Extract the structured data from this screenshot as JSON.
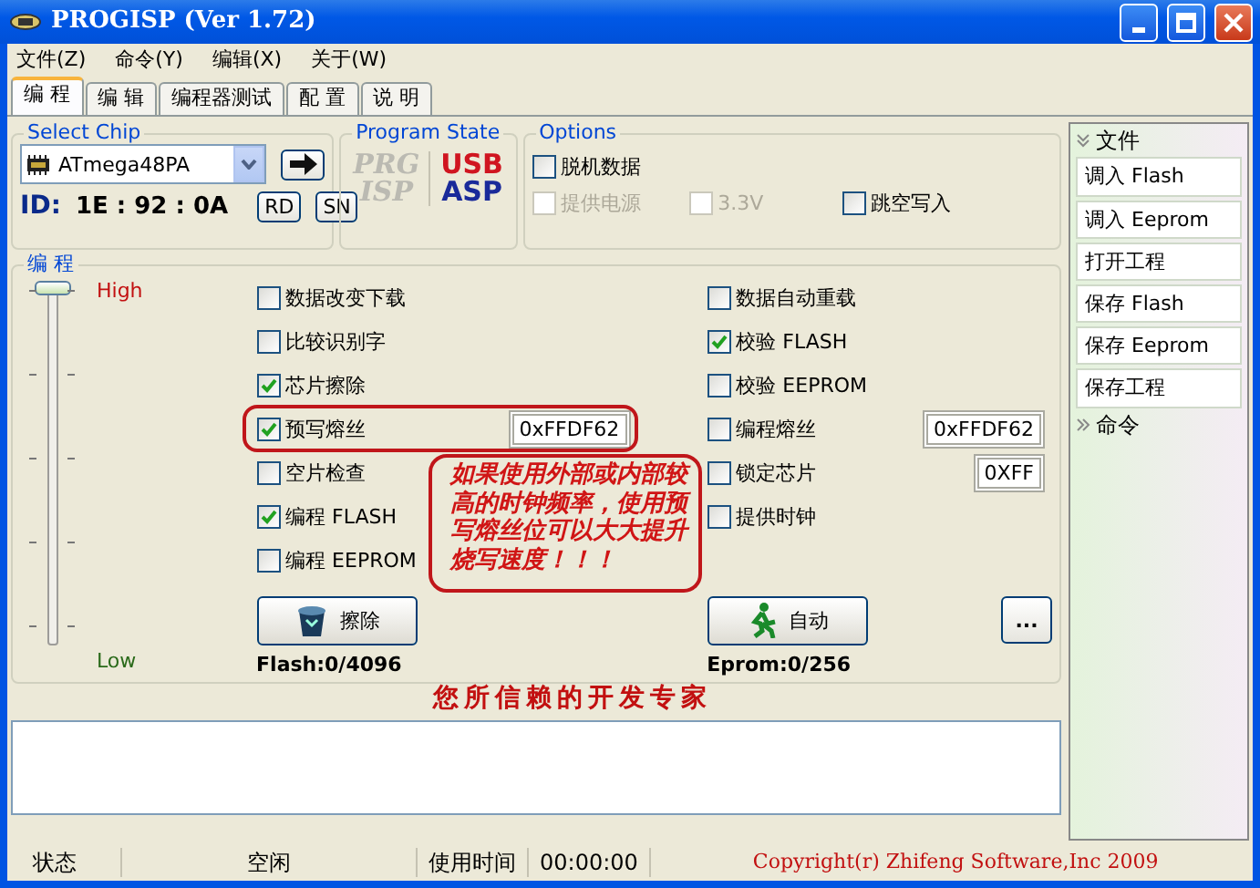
{
  "window": {
    "title": "PROGISP (Ver 1.72)"
  },
  "menu": [
    "文件(Z)",
    "命令(Y)",
    "编辑(X)",
    "关于(W)"
  ],
  "tabs": [
    {
      "label": "编 程",
      "selected": true
    },
    {
      "label": "编 辑",
      "selected": false
    },
    {
      "label": "编程器测试",
      "selected": false
    },
    {
      "label": "配 置",
      "selected": false
    },
    {
      "label": "说 明",
      "selected": false
    }
  ],
  "select_chip": {
    "title": "Select Chip",
    "chip": "ATmega48PA",
    "id_label": "ID:",
    "id_value": "1E : 92 : 0A",
    "buttons": [
      "RD",
      "SN"
    ]
  },
  "program_state": {
    "title": "Program State",
    "logos": [
      {
        "kind": "prg",
        "lines": [
          "PRG",
          "ISP"
        ]
      },
      {
        "kind": "usb",
        "lines": [
          "USB",
          "ASP"
        ]
      }
    ]
  },
  "options": {
    "title": "Options",
    "items": [
      {
        "label": "脱机数据",
        "checked": false,
        "disabled": false
      },
      {
        "label": "提供电源",
        "checked": false,
        "disabled": true
      },
      {
        "label": "3.3V",
        "checked": false,
        "disabled": true
      },
      {
        "label": "跳空写入",
        "checked": false,
        "disabled": false
      }
    ]
  },
  "program": {
    "title": "编 程",
    "speed": {
      "high": "High",
      "low": "Low",
      "level": 1
    },
    "left": [
      {
        "label": "数据改变下载",
        "checked": false
      },
      {
        "label": "比较识别字",
        "checked": false
      },
      {
        "label": "芯片擦除",
        "checked": true
      },
      {
        "label": "预写熔丝",
        "checked": true,
        "value": "0xFFDF62"
      },
      {
        "label": "空片检查",
        "checked": false
      },
      {
        "label": "编程 FLASH",
        "checked": true
      },
      {
        "label": "编程 EEPROM",
        "checked": false
      }
    ],
    "right": [
      {
        "label": "数据自动重载",
        "checked": false
      },
      {
        "label": "校验 FLASH",
        "checked": true
      },
      {
        "label": "校验 EEPROM",
        "checked": false
      },
      {
        "label": "编程熔丝",
        "checked": false,
        "value": "0xFFDF62"
      },
      {
        "label": "锁定芯片",
        "checked": false,
        "value": "0XFF"
      },
      {
        "label": "提供时钟",
        "checked": false
      }
    ],
    "erase_button": "擦除",
    "auto_button": "自动",
    "more_button": "...",
    "flash_count": "Flash:0/4096",
    "eprom_count": "Eprom:0/256"
  },
  "annotation": "如果使用外部或内部较高的时钟频率，使用预写熔丝位可以大大提升烧写速度！！！",
  "slogan": "您所信赖的开发专家",
  "sidebar": {
    "sections": [
      {
        "title": "文件",
        "expanded": true,
        "items": [
          "调入 Flash",
          "调入 Eeprom",
          "打开工程",
          "保存 Flash",
          "保存 Eeprom",
          "保存工程"
        ]
      },
      {
        "title": "命令",
        "expanded": false
      }
    ]
  },
  "status_bar": {
    "state_label": "状态",
    "state": "空闲",
    "time_label": "使用时间",
    "time": "00:00:00",
    "copyright": "Copyright(r) Zhifeng Software,Inc 2009"
  }
}
